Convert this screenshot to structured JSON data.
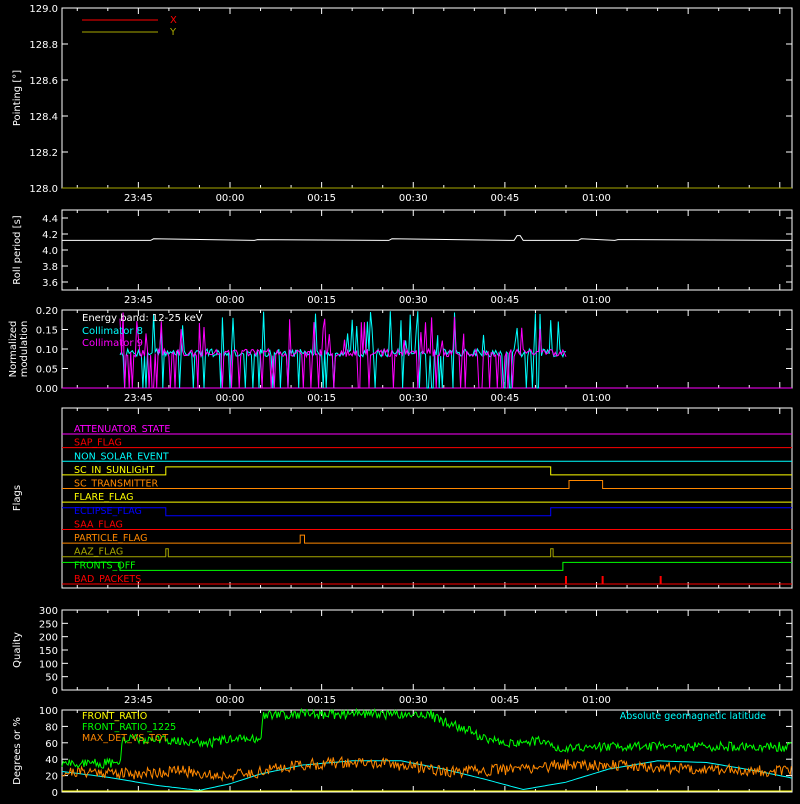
{
  "colors": {
    "background": "#000000",
    "axis": "#ffffff",
    "pointing_x": "#ff0000",
    "pointing_y": "#a8a800",
    "roll": "#ffffff",
    "collimator8": "#00ffff",
    "collimator9": "#ff00ff",
    "quality": "#ffffff",
    "front_ratio": "#ffff00",
    "front_ratio_1225": "#00ff00",
    "max_det_vs_tot": "#ff8800",
    "geomag": "#00ffff"
  },
  "time_axis": {
    "start_min": -27.5,
    "end_min": 92,
    "ticks": [
      {
        "min": -15,
        "label": "23:45"
      },
      {
        "min": 0,
        "label": "00:00"
      },
      {
        "min": 15,
        "label": "00:15"
      },
      {
        "min": 30,
        "label": "00:30"
      },
      {
        "min": 45,
        "label": "00:45"
      },
      {
        "min": 60,
        "label": "01:00"
      }
    ]
  },
  "chart_data": [
    {
      "type": "line",
      "id": "pointing",
      "ylabel": "Pointing [°]",
      "ylim": [
        128.0,
        129.0
      ],
      "yticks": [
        128.0,
        128.2,
        128.4,
        128.6,
        128.8,
        129.0
      ],
      "ytick_labels": [
        "128.0",
        "128.2",
        "128.4",
        "128.6",
        "128.8",
        "129.0"
      ],
      "legend": "top-left",
      "series": [
        {
          "name": "X",
          "color_key": "pointing_x",
          "x": [
            -27.5,
            92
          ],
          "y": [
            128.0,
            128.0
          ]
        },
        {
          "name": "Y",
          "color_key": "pointing_y",
          "x": [
            -27.5,
            92
          ],
          "y": [
            128.0,
            128.0
          ]
        }
      ]
    },
    {
      "type": "line",
      "id": "roll",
      "ylabel": "Roll period [s]",
      "ylim": [
        3.5,
        4.5
      ],
      "yticks": [
        3.6,
        3.8,
        4.0,
        4.2,
        4.4
      ],
      "ytick_labels": [
        "3.6",
        "3.8",
        "4.0",
        "4.2",
        "4.4"
      ],
      "series": [
        {
          "name": "",
          "color_key": "roll",
          "x": [
            -27.5,
            -13,
            -12.5,
            4,
            4.5,
            26,
            26.5,
            46.5,
            47,
            47.5,
            48,
            57,
            57.5,
            63,
            63.5,
            92
          ],
          "y": [
            4.12,
            4.12,
            4.14,
            4.12,
            4.13,
            4.12,
            4.14,
            4.12,
            4.18,
            4.18,
            4.12,
            4.12,
            4.14,
            4.12,
            4.13,
            4.12
          ]
        }
      ]
    },
    {
      "type": "line",
      "id": "modulation",
      "ylabel": "Normalized modulation",
      "ylim": [
        0.0,
        0.2
      ],
      "yticks": [
        0.0,
        0.05,
        0.1,
        0.15,
        0.2
      ],
      "ytick_labels": [
        "0.00",
        "0.05",
        "0.10",
        "0.15",
        "0.20"
      ],
      "legend_title": "Energy band: 12-25 keV",
      "legend": "top-left",
      "active_range": [
        -18,
        55
      ],
      "series": [
        {
          "name": "Collimator 8",
          "color_key": "collimator8"
        },
        {
          "name": "Collimator 9",
          "color_key": "collimator9"
        }
      ]
    },
    {
      "type": "line",
      "id": "flags",
      "ylabel": "Flags",
      "flags": [
        {
          "name": "ATTENUATOR_STATE",
          "color": "#ff00ff",
          "steps": []
        },
        {
          "name": "SAP_FLAG",
          "color": "#ff0000",
          "steps": []
        },
        {
          "name": "NON_SOLAR_EVENT",
          "color": "#00ffff",
          "steps": []
        },
        {
          "name": "SC_IN_SUNLIGHT",
          "color": "#ffff00",
          "steps": [
            [
              -27.5,
              0
            ],
            [
              -10.5,
              1
            ],
            [
              52.5,
              0
            ]
          ]
        },
        {
          "name": "SC_TRANSMITTER",
          "color": "#ff8800",
          "steps": [
            [
              -27.5,
              0
            ],
            [
              55.5,
              1
            ],
            [
              61,
              0
            ]
          ]
        },
        {
          "name": "FLARE_FLAG",
          "color": "#ffff00",
          "steps": []
        },
        {
          "name": "ECLIPSE_FLAG",
          "color": "#0000ff",
          "steps": [
            [
              -27.5,
              1
            ],
            [
              -10.5,
              0
            ],
            [
              52.5,
              1
            ]
          ]
        },
        {
          "name": "SAA_FLAG",
          "color": "#ff0000",
          "steps": []
        },
        {
          "name": "PARTICLE_FLAG",
          "color": "#ff8800",
          "steps": [
            [
              -27.5,
              0
            ],
            [
              11.5,
              1
            ],
            [
              12.2,
              0
            ]
          ]
        },
        {
          "name": "AAZ_FLAG",
          "color": "#a8a800",
          "steps": [
            [
              -27.5,
              0
            ],
            [
              -10.5,
              1
            ],
            [
              -10.1,
              0
            ],
            [
              52.5,
              1
            ],
            [
              52.9,
              0
            ]
          ]
        },
        {
          "name": "FRONTS_OFF",
          "color": "#00ff00",
          "steps": [
            [
              -27.5,
              1
            ],
            [
              -18,
              0
            ],
            [
              54.5,
              1
            ]
          ]
        },
        {
          "name": "BAD_PACKETS",
          "color": "#ff0000",
          "spikes": [
            55,
            61,
            70.5
          ]
        }
      ]
    },
    {
      "type": "line",
      "id": "quality",
      "ylabel": "Quality",
      "ylim": [
        0,
        300
      ],
      "yticks": [
        0,
        50,
        100,
        150,
        200,
        250,
        300
      ],
      "ytick_labels": [
        "0",
        "50",
        "100",
        "150",
        "200",
        "250",
        "300"
      ],
      "series": [
        {
          "name": "",
          "color_key": "quality",
          "x": [
            -27.5,
            92
          ],
          "y": [
            300,
            300
          ]
        }
      ]
    },
    {
      "type": "line",
      "id": "ratios",
      "ylabel": "Degrees or %",
      "ylim": [
        0,
        100
      ],
      "yticks": [
        0,
        20,
        40,
        60,
        80,
        100
      ],
      "ytick_labels": [
        "0",
        "20",
        "40",
        "60",
        "80",
        "100"
      ],
      "legend": "top-left",
      "series": [
        {
          "name": "FRONT_RATIO",
          "color_key": "front_ratio"
        },
        {
          "name": "FRONT_RATIO_1225",
          "color_key": "front_ratio_1225",
          "x": [
            -27.5,
            -18,
            -17.5,
            -3,
            -2.5,
            5,
            5.5,
            33,
            33.5,
            44,
            44.5,
            52,
            52.5,
            92
          ],
          "y": [
            35,
            35,
            65,
            60,
            62,
            65,
            95,
            95,
            90,
            60,
            60,
            62,
            55,
            55
          ]
        },
        {
          "name": "MAX_DET_VS_TOT",
          "color_key": "max_det_vs_tot",
          "x": [
            -27.5,
            -22,
            -16,
            -8,
            -2,
            3,
            10,
            18,
            26,
            32,
            36,
            42,
            50,
            56,
            62,
            70,
            78,
            86,
            92
          ],
          "y": [
            24,
            25,
            22,
            26,
            20,
            22,
            32,
            36,
            34,
            30,
            24,
            26,
            30,
            34,
            33,
            30,
            28,
            26,
            25
          ]
        },
        {
          "name": "Absolute geomagnetic latitude",
          "color_key": "geomag",
          "legend": "top-right",
          "x": [
            -27.5,
            -20,
            -12,
            -5,
            0,
            5,
            12,
            20,
            28,
            35,
            42,
            48,
            55,
            62,
            70,
            78,
            86,
            92
          ],
          "y": [
            25,
            18,
            8,
            2,
            10,
            22,
            33,
            38,
            38,
            28,
            15,
            3,
            12,
            28,
            38,
            36,
            26,
            17
          ]
        }
      ]
    }
  ]
}
